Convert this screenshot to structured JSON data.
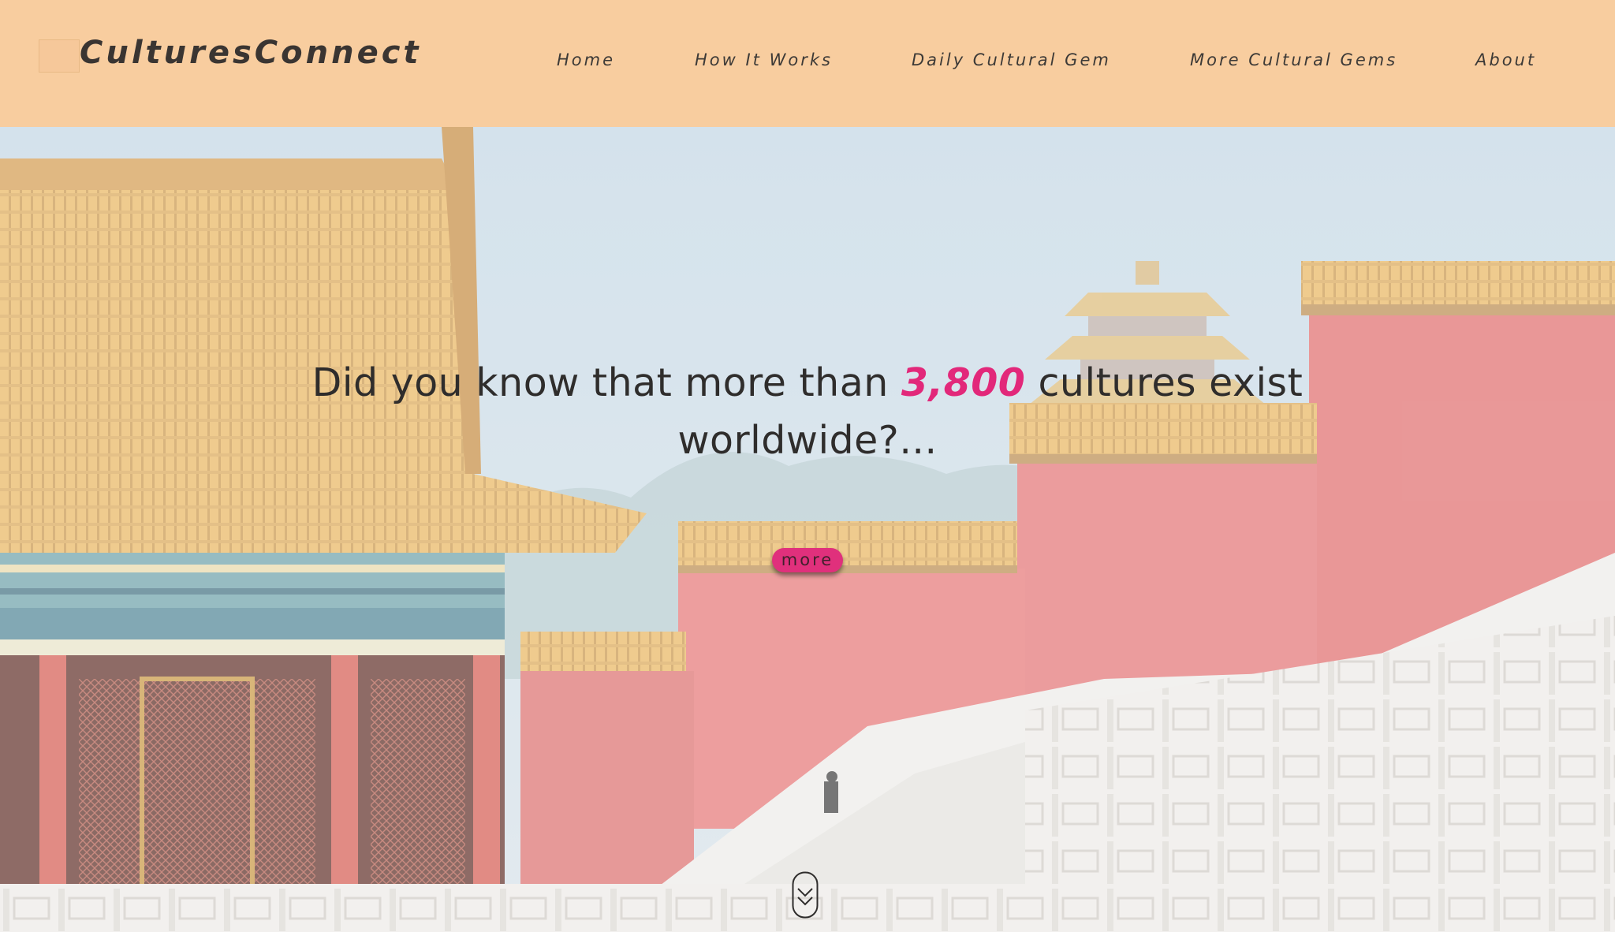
{
  "header": {
    "brand": "CulturesConnect",
    "nav": [
      {
        "label": "Home"
      },
      {
        "label": "How It Works"
      },
      {
        "label": "Daily Cultural Gem"
      },
      {
        "label": "More Cultural Gems"
      },
      {
        "label": "About"
      }
    ]
  },
  "hero": {
    "headline_before": "Did you know that more than ",
    "headline_number": "3,800",
    "headline_after": " cultures exist worldwide?...",
    "more_label": "more"
  },
  "icons": {
    "logo": "logo-placeholder",
    "scroll": "double-chevron-down-icon"
  },
  "colors": {
    "header_bg": "#f8cd9f",
    "accent": "#e2287a",
    "text": "#2f2d2c"
  }
}
